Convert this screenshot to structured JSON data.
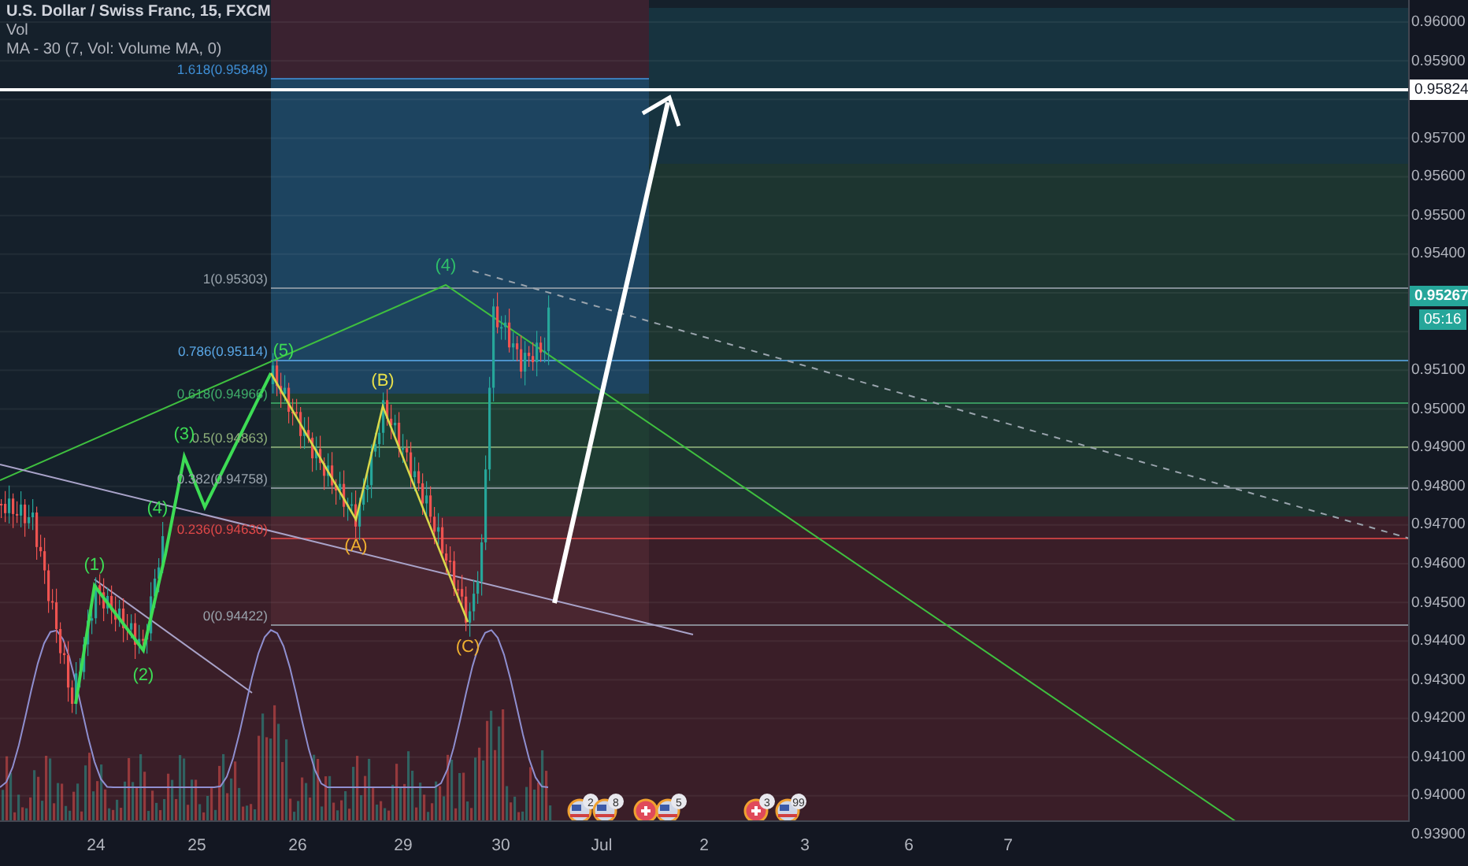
{
  "legend": {
    "title": "U.S. Dollar / Swiss Franc, 15, FXCM",
    "lines": [
      "Vol",
      "MA - 30 (7, Vol: Volume MA, 0)"
    ]
  },
  "fib_levels": [
    {
      "label": "1.618(0.95848)",
      "color": "#3f8fd6"
    },
    {
      "label": "1(0.95303)",
      "color": "#9aa4ad"
    },
    {
      "label": "0.786(0.95114)",
      "color": "#5aa7e6"
    },
    {
      "label": "0.618(0.94966)",
      "color": "#3fae6a"
    },
    {
      "label": "0.5(0.94863)",
      "color": "#8fb07a"
    },
    {
      "label": "0.382(0.94758)",
      "color": "#9aa4ad"
    },
    {
      "label": "0.236(0.94630)",
      "color": "#e04848"
    },
    {
      "label": "0(0.94422)",
      "color": "#9aa4ad"
    }
  ],
  "wave_labels": [
    {
      "text": "(1)",
      "color": "#3ddc55"
    },
    {
      "text": "(2)",
      "color": "#3ddc55"
    },
    {
      "text": "(3)",
      "color": "#3ddc55"
    },
    {
      "text": "(4)",
      "color": "#3ddc55"
    },
    {
      "text": "(5)",
      "color": "#3ddc55"
    },
    {
      "text": "(4)",
      "color": "#2fbf6a"
    },
    {
      "text": "(B)",
      "color": "#e8e04a"
    },
    {
      "text": "(A)",
      "color": "#f0b030"
    },
    {
      "text": "(C)",
      "color": "#f0b030"
    }
  ],
  "price_axis": [
    "0.96000",
    "0.95900",
    "0.95700",
    "0.95600",
    "0.95500",
    "0.95400",
    "0.95100",
    "0.95000",
    "0.94900",
    "0.94800",
    "0.94700",
    "0.94600",
    "0.94500",
    "0.94400",
    "0.94300",
    "0.94200",
    "0.94100",
    "0.94000",
    "0.93900"
  ],
  "price_tags": [
    {
      "kind": "line",
      "text": "0.95824"
    },
    {
      "kind": "last",
      "text": "0.95267"
    },
    {
      "kind": "countdown",
      "text": "05:16"
    }
  ],
  "time_axis": [
    "24",
    "25",
    "26",
    "29",
    "30",
    "Jul",
    "2",
    "3",
    "6",
    "7"
  ],
  "events": [
    {
      "kind": "us",
      "count": "2"
    },
    {
      "kind": "us",
      "count": "8"
    },
    {
      "kind": "ch"
    },
    {
      "kind": "us",
      "count": "5"
    },
    {
      "kind": "ch",
      "count": "3"
    },
    {
      "kind": "us",
      "count": "99"
    }
  ]
}
